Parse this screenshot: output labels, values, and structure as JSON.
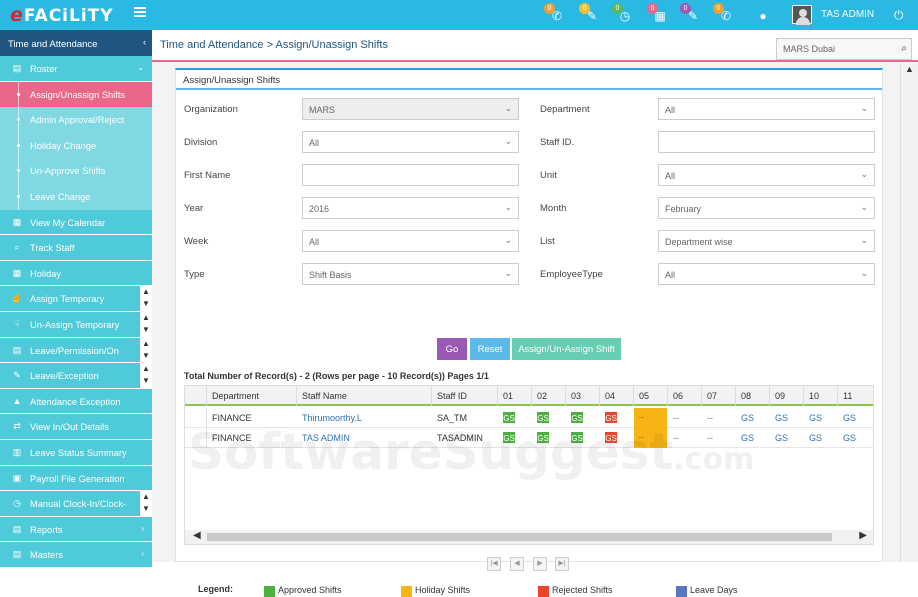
{
  "app": {
    "logo": "FACiLiTY",
    "logo_prefix": "e"
  },
  "topbar": {
    "icons": [
      {
        "name": "phone-icon",
        "glyph": "✆",
        "badge": "0",
        "color": "#f0a030"
      },
      {
        "name": "wrench-icon",
        "glyph": "✎",
        "badge": "0",
        "color": "#f0c030"
      },
      {
        "name": "clock-icon",
        "glyph": "◷",
        "badge": "0",
        "color": "#5cb85c"
      },
      {
        "name": "calendar-icon",
        "glyph": "▦",
        "badge": "0",
        "color": "#e9678a"
      },
      {
        "name": "tools-icon",
        "glyph": "✎",
        "badge": "0",
        "color": "#9b59b6"
      },
      {
        "name": "call-icon",
        "glyph": "✆",
        "badge": "0",
        "color": "#f0a030"
      },
      {
        "name": "globe-icon",
        "glyph": "●",
        "badge": "",
        "color": ""
      }
    ],
    "username": "TAS ADMIN"
  },
  "sidebar": {
    "header": "Time and Attendance",
    "items": [
      {
        "label": "Roster",
        "icon": "▤",
        "name": "sidebar-item-roster",
        "arrow": "⌄"
      },
      {
        "label": "Assign/Unassign Shifts",
        "sub": true,
        "active": true,
        "name": "sidebar-item-assign-unassign-shifts"
      },
      {
        "label": "Admin Approval/Reject",
        "sub": true,
        "name": "sidebar-item-admin-approval"
      },
      {
        "label": "Holiday Change",
        "sub": true,
        "name": "sidebar-item-holiday-change"
      },
      {
        "label": "Un-Approve Shifts",
        "sub": true,
        "name": "sidebar-item-unapprove-shifts"
      },
      {
        "label": "Leave Change",
        "sub": true,
        "name": "sidebar-item-leave-change"
      },
      {
        "label": "View My Calendar",
        "icon": "▦",
        "name": "sidebar-item-view-my-calendar"
      },
      {
        "label": "Track Staff",
        "icon": "⌕",
        "name": "sidebar-item-track-staff"
      },
      {
        "label": "Holiday",
        "icon": "▦",
        "name": "sidebar-item-holiday"
      },
      {
        "label": "Assign Temporary",
        "icon": "☝",
        "name": "sidebar-item-assign-temporary",
        "updown": true
      },
      {
        "label": "Un-Assign Temporary",
        "icon": "☟",
        "name": "sidebar-item-unassign-temporary",
        "updown": true
      },
      {
        "label": "Leave/Permission/On",
        "icon": "▤",
        "name": "sidebar-item-leave-permission",
        "updown": true
      },
      {
        "label": "Leave/Exception",
        "icon": "✎",
        "name": "sidebar-item-leave-exception",
        "updown": true
      },
      {
        "label": "Attendance Exception",
        "icon": "▲",
        "name": "sidebar-item-attendance-exception"
      },
      {
        "label": "View In/Out Details",
        "icon": "⇄",
        "name": "sidebar-item-view-inout"
      },
      {
        "label": "Leave Status Summary",
        "icon": "▥",
        "name": "sidebar-item-leave-status-summary"
      },
      {
        "label": "Payroll File Generation",
        "icon": "▣",
        "name": "sidebar-item-payroll-file"
      },
      {
        "label": "Manual Clock-In/Clock-",
        "icon": "◷",
        "name": "sidebar-item-manual-clock",
        "updown": true
      },
      {
        "label": "Reports",
        "icon": "▤",
        "name": "sidebar-item-reports",
        "arrow": "›"
      },
      {
        "label": "Masters",
        "icon": "▤",
        "name": "sidebar-item-masters",
        "arrow": "›"
      }
    ]
  },
  "breadcrumb": "Time and Attendance > Assign/Unassign Shifts",
  "location": "MARS Dubai",
  "panel": {
    "title": "Assign/Unassign Shifts",
    "fields_left": [
      {
        "label": "Organization",
        "value": "MARS",
        "select": true,
        "disabled": true
      },
      {
        "label": "Division",
        "value": "All",
        "select": true
      },
      {
        "label": "First Name",
        "value": "",
        "select": false
      },
      {
        "label": "Year",
        "value": "2016",
        "select": true
      },
      {
        "label": "Week",
        "value": "All",
        "select": true
      },
      {
        "label": "Type",
        "value": "Shift Basis",
        "select": true
      }
    ],
    "fields_right": [
      {
        "label": "Department",
        "value": "All",
        "select": true
      },
      {
        "label": "Staff ID.",
        "value": "",
        "select": false
      },
      {
        "label": "Unit",
        "value": "All",
        "select": true
      },
      {
        "label": "Month",
        "value": "February",
        "select": true
      },
      {
        "label": "List",
        "value": "Department wise",
        "select": true
      },
      {
        "label": "EmployeeType",
        "value": "All",
        "select": true
      }
    ],
    "buttons": {
      "go": "Go",
      "reset": "Reset",
      "assign": "Assign/Un-Assign Shift"
    },
    "totals": "Total Number of Record(s) - 2 (Rows per page - 10 Record(s)) Pages 1/1"
  },
  "grid": {
    "headers": [
      "Department",
      "Staff Name",
      "Staff ID",
      "01",
      "02",
      "03",
      "04",
      "05",
      "06",
      "07",
      "08",
      "09",
      "10",
      "11"
    ],
    "rows": [
      {
        "department": "FINANCE",
        "staff_name": "Thirumoorthy.L",
        "staff_id": "SA_TM",
        "days": [
          {
            "t": "GS",
            "k": "approved"
          },
          {
            "t": "GS",
            "k": "approved"
          },
          {
            "t": "GS",
            "k": "approved"
          },
          {
            "t": "GS",
            "k": "rejected"
          },
          {
            "t": "--",
            "k": "holiday"
          },
          {
            "t": "--",
            "k": "plain"
          },
          {
            "t": "--",
            "k": "plain"
          },
          {
            "t": "GS",
            "k": "link"
          },
          {
            "t": "GS",
            "k": "link"
          },
          {
            "t": "GS",
            "k": "link"
          },
          {
            "t": "GS",
            "k": "link"
          }
        ]
      },
      {
        "department": "FINANCE",
        "staff_name": "TAS ADMIN",
        "staff_id": "TASADMIN",
        "days": [
          {
            "t": "GS",
            "k": "approved"
          },
          {
            "t": "GS",
            "k": "approved"
          },
          {
            "t": "GS",
            "k": "approved"
          },
          {
            "t": "GS",
            "k": "rejected"
          },
          {
            "t": "--",
            "k": "holiday"
          },
          {
            "t": "--",
            "k": "plain"
          },
          {
            "t": "--",
            "k": "plain"
          },
          {
            "t": "GS",
            "k": "link"
          },
          {
            "t": "GS",
            "k": "link"
          },
          {
            "t": "GS",
            "k": "link"
          },
          {
            "t": "GS",
            "k": "link"
          }
        ]
      }
    ]
  },
  "legend": {
    "title": "Legend:",
    "items": [
      {
        "label": "Approved Shifts",
        "color": "#4caf3f"
      },
      {
        "label": "Holiday Shifts",
        "color": "#f7b515"
      },
      {
        "label": "Rejected Shifts",
        "color": "#e8452b"
      },
      {
        "label": "Leave Days",
        "color": "#5a76c2"
      }
    ]
  },
  "colors": {
    "approved": "#4caf3f",
    "rejected": "#e8452b",
    "holiday": "#f7b515",
    "go": "#9b59b6",
    "reset": "#5ab9e6",
    "assign": "#67cdb3"
  },
  "watermark": {
    "main": "SoftwareSuggest",
    "suffix": ".com"
  }
}
